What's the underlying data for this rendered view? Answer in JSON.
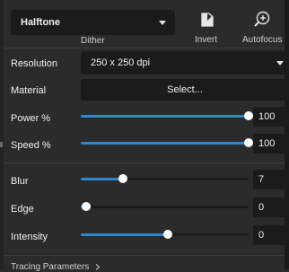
{
  "top": {
    "mode_value": "Halftone",
    "mode_caption": "Dither",
    "invert_label": "Invert",
    "autofocus_label": "Autofocus"
  },
  "resolution": {
    "label": "Resolution",
    "value": "250 x 250 dpi"
  },
  "material": {
    "label": "Material",
    "button": "Select..."
  },
  "power": {
    "label": "Power %",
    "value": "100",
    "fraction": 1.0
  },
  "speed": {
    "label": "Speed %",
    "value": "100",
    "fraction": 1.0
  },
  "blur": {
    "label": "Blur",
    "value": "7",
    "fraction": 0.25
  },
  "edge": {
    "label": "Edge",
    "value": "0",
    "fraction": 0.03
  },
  "intensity": {
    "label": "Intensity",
    "value": "0",
    "fraction": 0.52
  },
  "footer": {
    "label": "Tracing Parameters"
  },
  "colors": {
    "accent": "#2b86d4",
    "background": "#2b2b2b",
    "field": "#1b1b1b"
  },
  "icons": {
    "invert": "invert-icon",
    "autofocus": "autofocus-icon"
  }
}
